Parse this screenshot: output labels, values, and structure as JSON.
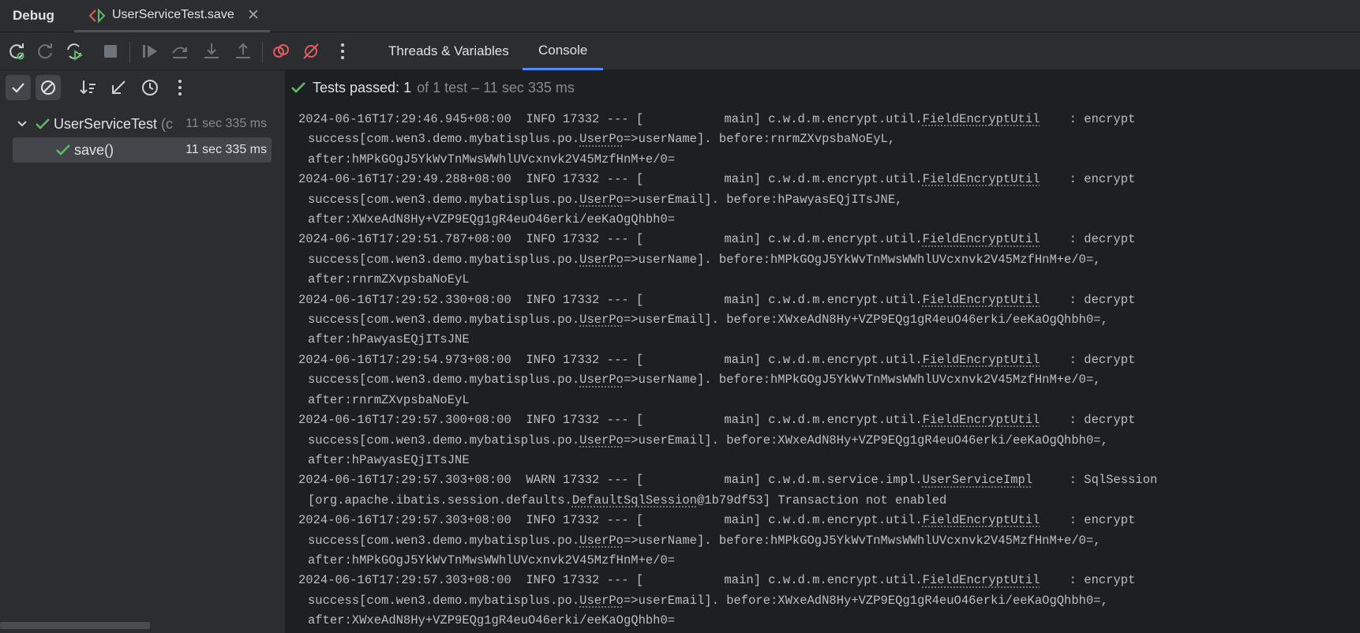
{
  "window": {
    "title": "Debug"
  },
  "tab": {
    "label": "UserServiceTest.save",
    "close": "✕"
  },
  "view_tabs": [
    "Threads & Variables",
    "Console"
  ],
  "colors": {
    "pass_green": "#5fb865",
    "stop_red": "#e55b5b",
    "accent": "#548af7"
  },
  "status": {
    "label": "Tests passed:",
    "count": "1",
    "detail": "of 1 test – 11 sec 335 ms"
  },
  "tree": [
    {
      "name": "UserServiceTest",
      "suffix": "(c",
      "time": "11 sec 335 ms"
    },
    {
      "name": "save()",
      "time": "11 sec 335 ms"
    }
  ],
  "logs": [
    {
      "head": "2024-06-16T17:29:46.945+08:00  INFO 17332 --- [           main] c.w.d.m.encrypt.util.",
      "cls": "FieldEncryptUtil",
      "tail": "    : encrypt",
      "l2a": "success[com.wen3.demo.mybatisplus.po.",
      "l2u": "UserPo",
      "l2b": "=>userName]. before:rnrmZXvpsbaNoEyL,",
      "l3": "after:hMPkGOgJ5YkWvTnMwsWWhlUVcxnvk2V45MzfHnM+e/0="
    },
    {
      "head": "2024-06-16T17:29:49.288+08:00  INFO 17332 --- [           main] c.w.d.m.encrypt.util.",
      "cls": "FieldEncryptUtil",
      "tail": "    : encrypt",
      "l2a": "success[com.wen3.demo.mybatisplus.po.",
      "l2u": "UserPo",
      "l2b": "=>userEmail]. before:hPawyasEQjITsJNE,",
      "l3": "after:XWxeAdN8Hy+VZP9EQg1gR4euO46erki/eeKaOgQhbh0="
    },
    {
      "head": "2024-06-16T17:29:51.787+08:00  INFO 17332 --- [           main] c.w.d.m.encrypt.util.",
      "cls": "FieldEncryptUtil",
      "tail": "    : decrypt",
      "l2a": "success[com.wen3.demo.mybatisplus.po.",
      "l2u": "UserPo",
      "l2b": "=>userName]. before:hMPkGOgJ5YkWvTnMwsWWhlUVcxnvk2V45MzfHnM+e/0=,",
      "l3": "after:rnrmZXvpsbaNoEyL"
    },
    {
      "head": "2024-06-16T17:29:52.330+08:00  INFO 17332 --- [           main] c.w.d.m.encrypt.util.",
      "cls": "FieldEncryptUtil",
      "tail": "    : decrypt",
      "l2a": "success[com.wen3.demo.mybatisplus.po.",
      "l2u": "UserPo",
      "l2b": "=>userEmail]. before:XWxeAdN8Hy+VZP9EQg1gR4euO46erki/eeKaOgQhbh0=,",
      "l3": "after:hPawyasEQjITsJNE"
    },
    {
      "head": "2024-06-16T17:29:54.973+08:00  INFO 17332 --- [           main] c.w.d.m.encrypt.util.",
      "cls": "FieldEncryptUtil",
      "tail": "    : decrypt",
      "l2a": "success[com.wen3.demo.mybatisplus.po.",
      "l2u": "UserPo",
      "l2b": "=>userName]. before:hMPkGOgJ5YkWvTnMwsWWhlUVcxnvk2V45MzfHnM+e/0=,",
      "l3": "after:rnrmZXvpsbaNoEyL"
    },
    {
      "head": "2024-06-16T17:29:57.300+08:00  INFO 17332 --- [           main] c.w.d.m.encrypt.util.",
      "cls": "FieldEncryptUtil",
      "tail": "    : decrypt",
      "l2a": "success[com.wen3.demo.mybatisplus.po.",
      "l2u": "UserPo",
      "l2b": "=>userEmail]. before:XWxeAdN8Hy+VZP9EQg1gR4euO46erki/eeKaOgQhbh0=,",
      "l3": "after:hPawyasEQjITsJNE"
    },
    {
      "head": "2024-06-16T17:29:57.303+08:00  WARN 17332 --- [           main] c.w.d.m.service.impl.",
      "cls": "UserServiceImpl",
      "tail": "     : SqlSession",
      "l2a": "[org.apache.ibatis.session.defaults.",
      "l2u": "DefaultSqlSession",
      "l2b": "@1b79df53] Transaction not enabled",
      "l3": ""
    },
    {
      "head": "2024-06-16T17:29:57.303+08:00  INFO 17332 --- [           main] c.w.d.m.encrypt.util.",
      "cls": "FieldEncryptUtil",
      "tail": "    : encrypt",
      "l2a": "success[com.wen3.demo.mybatisplus.po.",
      "l2u": "UserPo",
      "l2b": "=>userName]. before:hMPkGOgJ5YkWvTnMwsWWhlUVcxnvk2V45MzfHnM+e/0=,",
      "l3": "after:hMPkGOgJ5YkWvTnMwsWWhlUVcxnvk2V45MzfHnM+e/0="
    },
    {
      "head": "2024-06-16T17:29:57.303+08:00  INFO 17332 --- [           main] c.w.d.m.encrypt.util.",
      "cls": "FieldEncryptUtil",
      "tail": "    : encrypt",
      "l2a": "success[com.wen3.demo.mybatisplus.po.",
      "l2u": "UserPo",
      "l2b": "=>userEmail]. before:XWxeAdN8Hy+VZP9EQg1gR4euO46erki/eeKaOgQhbh0=,",
      "l3": "after:XWxeAdN8Hy+VZP9EQg1gR4euO46erki/eeKaOgQhbh0="
    }
  ]
}
